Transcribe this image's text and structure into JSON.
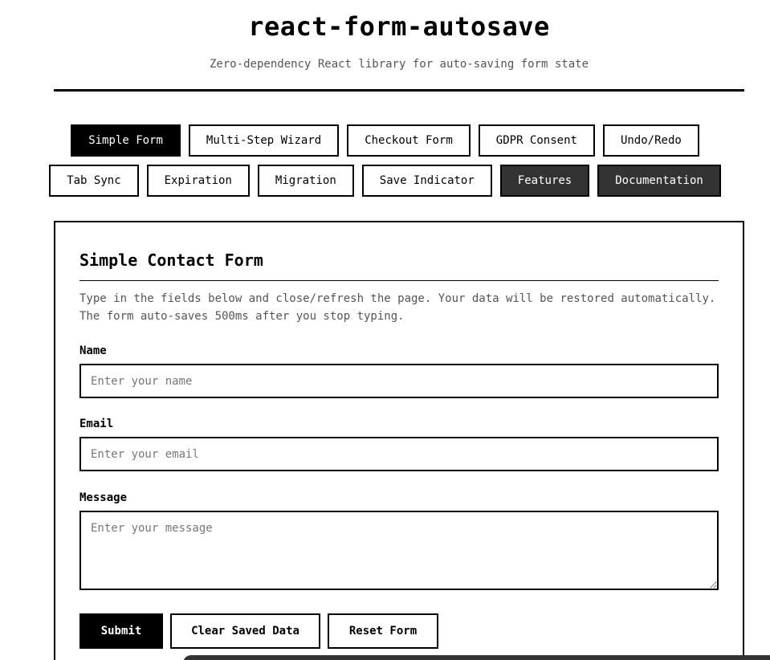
{
  "header": {
    "title": "react-form-autosave",
    "subtitle": "Zero-dependency React library for auto-saving form state"
  },
  "nav": {
    "row1": [
      {
        "label": "Simple Form",
        "state": "active"
      },
      {
        "label": "Multi-Step Wizard",
        "state": "default"
      },
      {
        "label": "Checkout Form",
        "state": "default"
      },
      {
        "label": "GDPR Consent",
        "state": "default"
      },
      {
        "label": "Undo/Redo",
        "state": "default"
      }
    ],
    "row2": [
      {
        "label": "Tab Sync",
        "state": "default"
      },
      {
        "label": "Expiration",
        "state": "default"
      },
      {
        "label": "Migration",
        "state": "default"
      },
      {
        "label": "Save Indicator",
        "state": "default"
      },
      {
        "label": "Features",
        "state": "dark"
      },
      {
        "label": "Documentation",
        "state": "dark"
      }
    ]
  },
  "form": {
    "title": "Simple Contact Form",
    "description": "Type in the fields below and close/refresh the page. Your data will be restored automatically. The form auto-saves 500ms after you stop typing.",
    "name_label": "Name",
    "name_placeholder": "Enter your name",
    "name_value": "",
    "email_label": "Email",
    "email_placeholder": "Enter your email",
    "email_value": "",
    "message_label": "Message",
    "message_placeholder": "Enter your message",
    "message_value": "",
    "submit_label": "Submit",
    "clear_label": "Clear Saved Data",
    "reset_label": "Reset Form"
  },
  "colors": {
    "active_tab": "#000000",
    "dark_tab": "#333333",
    "muted_text": "#555555"
  }
}
